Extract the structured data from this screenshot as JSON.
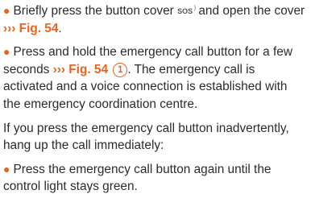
{
  "colors": {
    "accent": "#e8631e",
    "text": "#2b2b2b"
  },
  "icons": {
    "bullet": "bullet-dot",
    "sos": "sos-button-symbol",
    "crossref": "chevron-arrows"
  },
  "glyphs": {
    "bullet": "●",
    "sos": "SOS",
    "sos_wave": ")",
    "crossref": "›››"
  },
  "step1": {
    "text_a": "Briefly press the button cover ",
    "text_b": " and open the cover ",
    "ref": "Fig. 54",
    "end": "."
  },
  "step2": {
    "text_a": "Press and hold the emergency call button for a few seconds ",
    "ref": "Fig. 54",
    "callout": "1",
    "text_b": ". The emergency call is activated and a voice connection is established with the emergency coordination centre."
  },
  "note": {
    "text": "If you press the emergency call button inadvertently, hang up the call immediately:"
  },
  "step3": {
    "text": "Press the emergency call button again until the control light stays green."
  }
}
